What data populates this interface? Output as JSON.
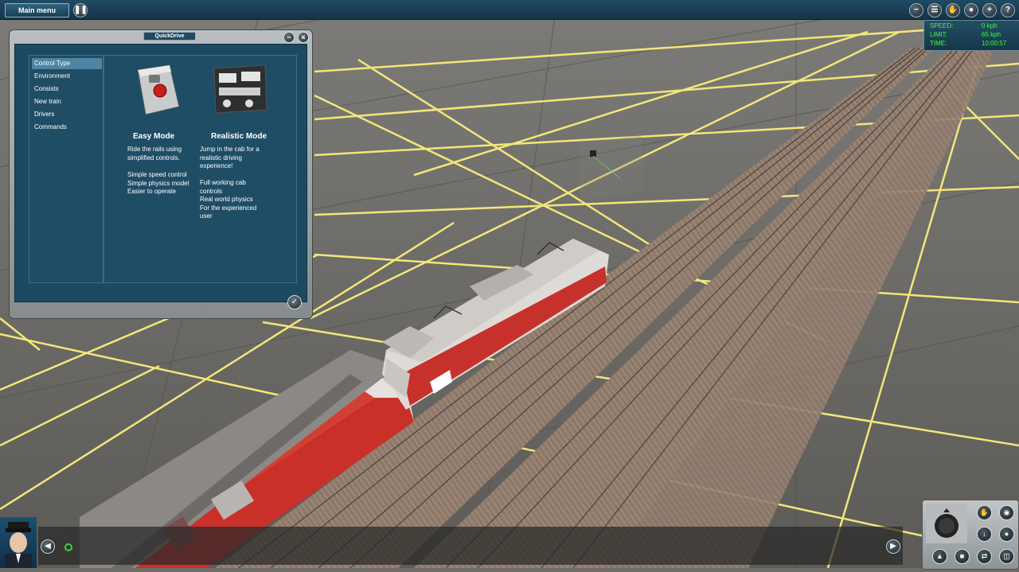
{
  "topbar": {
    "main_menu_label": "Main menu",
    "left_icon": "pause-icon",
    "right_icons": [
      "minus-icon",
      "layers-icon",
      "pan-icon",
      "camera-icon",
      "plus-icon",
      "help-icon"
    ]
  },
  "hud": {
    "speed_label": "SPEED:",
    "speed_value": "0 kph",
    "limit_label": "LIMIT:",
    "limit_value": "65 kph",
    "time_label": "TIME:",
    "time_value": "10:00:57"
  },
  "quickdrive": {
    "title": "QuickDrive",
    "nav": [
      {
        "label": "Control Type",
        "active": true
      },
      {
        "label": "Environment",
        "active": false
      },
      {
        "label": "Consists",
        "active": false
      },
      {
        "label": "New train",
        "active": false
      },
      {
        "label": "Drivers",
        "active": false
      },
      {
        "label": "Commands",
        "active": false
      }
    ],
    "modes": {
      "easy": {
        "title": "Easy Mode",
        "desc": "Ride the rails using\nsimplified controls.",
        "features": "Simple speed control\nSimple physics model\nEasier to operate"
      },
      "realistic": {
        "title": "Realistic Mode",
        "desc": "Jump in the cab for a\nrealistic driving\nexperience!",
        "features": "Full working cab\ncontrols\nReal world physics\nFor the experienced\nuser"
      }
    }
  },
  "colors": {
    "grid_line": "#f3e67a",
    "ui_panel": "#1d4a63",
    "hud_text": "#3cff3c",
    "train_red": "#c7312c"
  }
}
